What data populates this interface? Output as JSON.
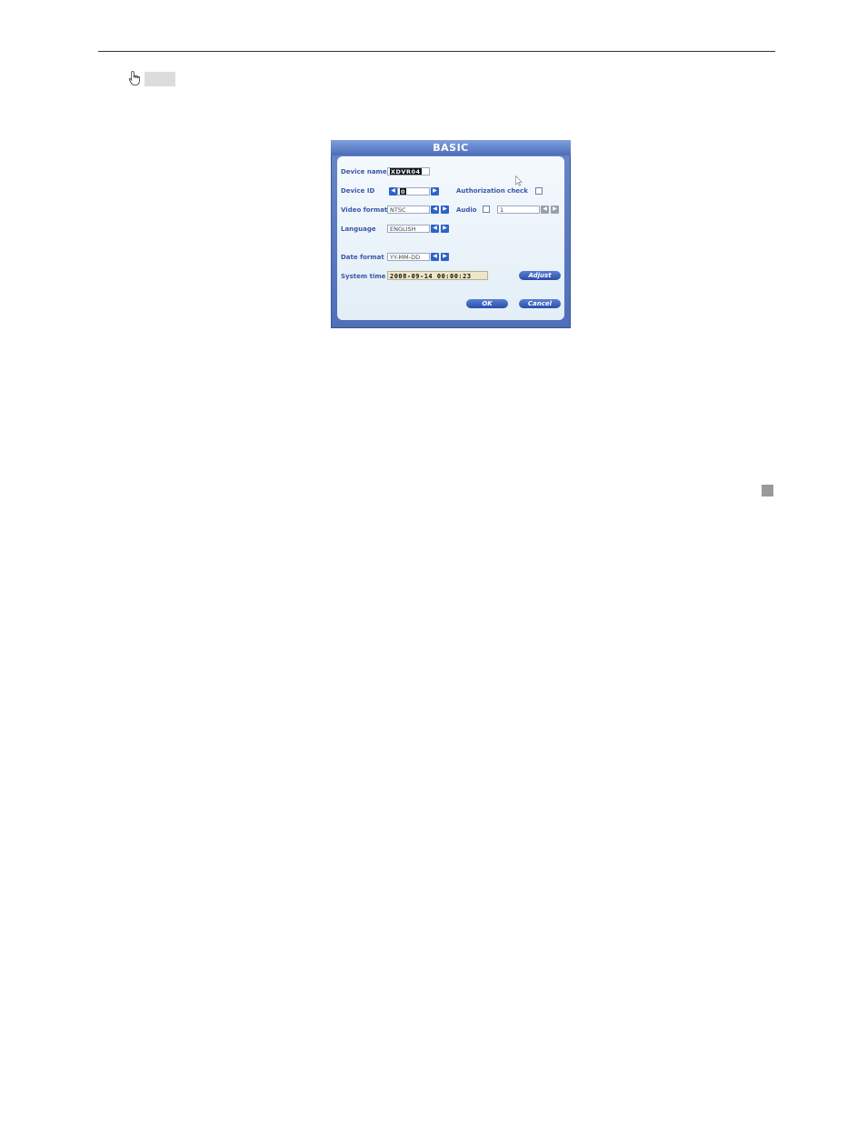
{
  "dialog": {
    "title": "BASIC",
    "device_name": {
      "label": "Device name",
      "value": "XDVR04"
    },
    "device_id": {
      "label": "Device ID",
      "value": "0"
    },
    "authorization_check": {
      "label": "Authorization check",
      "checked": false
    },
    "video_format": {
      "label": "Video format",
      "value": "NTSC"
    },
    "audio": {
      "label": "Audio",
      "checked": false,
      "value": "1"
    },
    "language": {
      "label": "Language",
      "value": "ENGLISH"
    },
    "date_format": {
      "label": "Date format",
      "value": "YY-MM-DD"
    },
    "system_time": {
      "label": "System time",
      "value": "2008-09-14  00:00:23"
    },
    "buttons": {
      "adjust": "Adjust",
      "ok": "OK",
      "cancel": "Cancel"
    }
  },
  "icons": {
    "pointer": "hand-pointer-icon",
    "arrow_left": "◀",
    "arrow_right": "▶"
  },
  "colors": {
    "frame": "#4f6fb8",
    "panel": "#e9f2f9",
    "label": "#3a57a6",
    "button": "#2a4fa6"
  }
}
